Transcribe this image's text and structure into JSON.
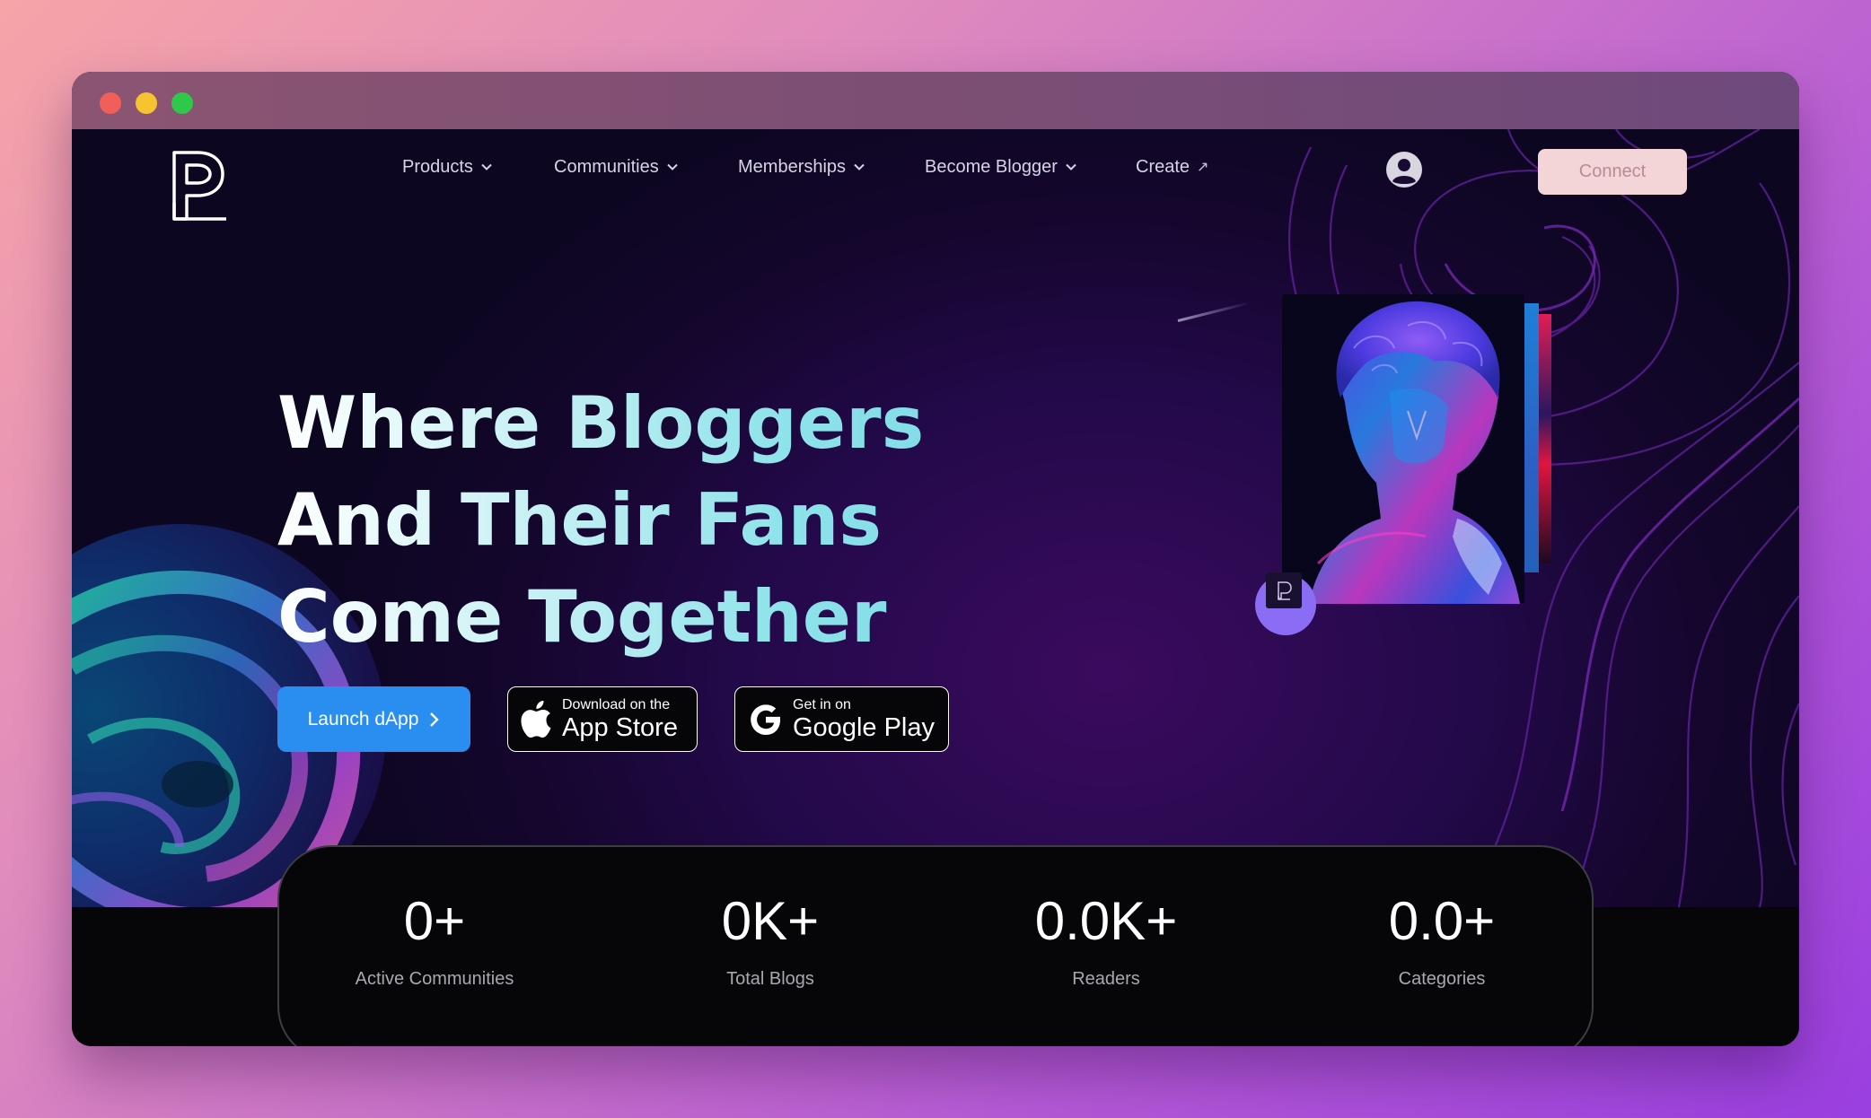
{
  "window": {
    "controls": [
      "close",
      "minimize",
      "maximize"
    ]
  },
  "brand": {
    "logo_icon": "p-monogram-logo"
  },
  "nav": {
    "items": [
      {
        "label": "Products",
        "icon": "chevron-down-icon"
      },
      {
        "label": "Communities",
        "icon": "chevron-down-icon"
      },
      {
        "label": "Memberships",
        "icon": "chevron-down-icon"
      },
      {
        "label": "Become Blogger",
        "icon": "chevron-down-icon"
      },
      {
        "label": "Create",
        "icon": "arrow-up-right-icon",
        "arrow": "↗"
      }
    ],
    "user_icon": "user-circle-icon",
    "connect_label": "Connect"
  },
  "hero": {
    "headline_lines": [
      "Where Bloggers",
      "And Their Fans",
      "Come Together"
    ],
    "launch_label": "Launch dApp",
    "app_store": {
      "small": "Download on the",
      "big": "App Store",
      "icon": "apple-icon"
    },
    "google_play": {
      "small": "Get in on",
      "big": "Google Play",
      "icon": "google-icon"
    }
  },
  "stats": [
    {
      "value": "0+",
      "label": "Active Communities"
    },
    {
      "value": "0K+",
      "label": "Total Blogs"
    },
    {
      "value": "0.0K+",
      "label": "Readers"
    },
    {
      "value": "0.0+",
      "label": "Categories"
    }
  ],
  "colors": {
    "accent_blue": "#2a8ef0",
    "connect_bg": "#f4d5d7",
    "headline_gradient_end": "#7dd9e6",
    "hero_bg": "#23094a"
  }
}
